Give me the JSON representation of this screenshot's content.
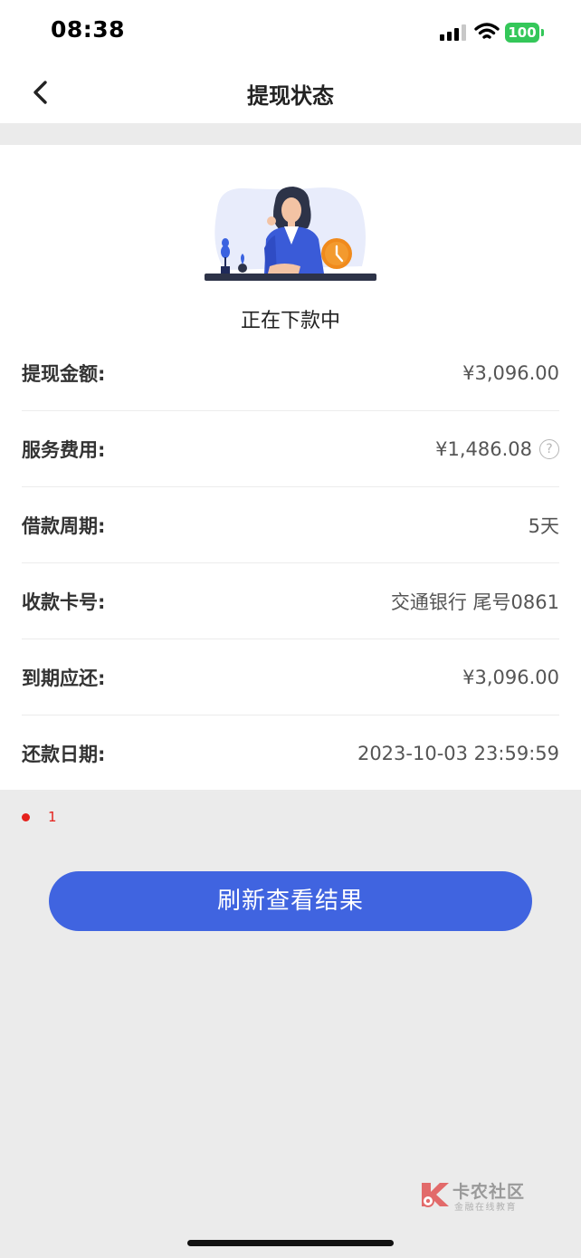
{
  "status_bar": {
    "time": "08:38",
    "battery": "100",
    "signal_icon": "cellular-signal-icon",
    "wifi_icon": "wifi-icon",
    "battery_color": "#34c759"
  },
  "nav": {
    "title": "提现状态",
    "back_icon": "chevron-left-icon"
  },
  "status": {
    "illustration": "woman-waiting-with-clock-illustration",
    "text": "正在下款中"
  },
  "details": [
    {
      "label": "提现金额:",
      "value": "¥3,096.00",
      "help": false
    },
    {
      "label": "服务费用:",
      "value": "¥1,486.08",
      "help": true
    },
    {
      "label": "借款周期:",
      "value": "5天",
      "help": false
    },
    {
      "label": "收款卡号:",
      "value": "交通银行 尾号0861",
      "help": false
    },
    {
      "label": "到期应还:",
      "value": "¥3,096.00",
      "help": false
    },
    {
      "label": "还款日期:",
      "value": "2023-10-03 23:59:59",
      "help": false
    }
  ],
  "help_icon_glyph": "?",
  "note": {
    "text": "1",
    "color": "#e5211c"
  },
  "refresh_button": {
    "label": "刷新查看结果",
    "color": "#4064e0"
  },
  "watermark": {
    "title": "卡农社区",
    "subtitle": "金融在线教育"
  }
}
